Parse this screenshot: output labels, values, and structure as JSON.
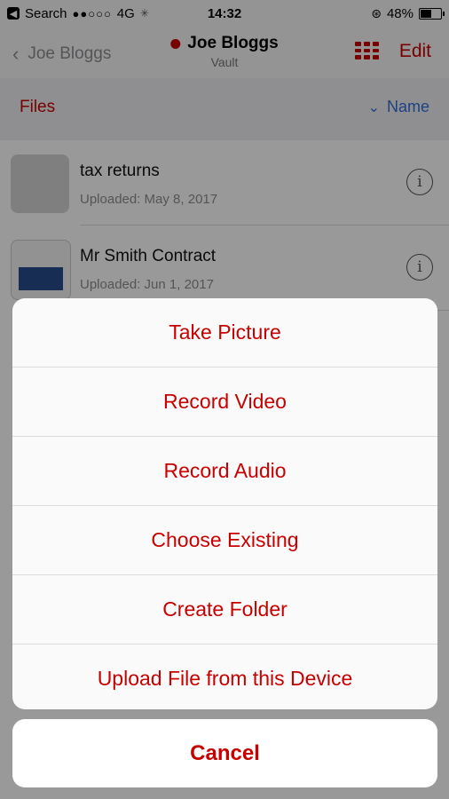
{
  "status_bar": {
    "carrier": "Search",
    "signal": "●●○○○",
    "network": "4G",
    "time": "14:32",
    "battery": "48%",
    "battery_level": 0.48
  },
  "nav": {
    "back_label": "Joe Bloggs",
    "title": "Joe Bloggs",
    "subtitle": "Vault",
    "edit_label": "Edit"
  },
  "files_header": {
    "title": "Files",
    "sort_label": "Name"
  },
  "files": [
    {
      "name": "tax returns",
      "date": "Uploaded: May 8, 2017"
    },
    {
      "name": "Mr Smith Contract",
      "date": "Uploaded: Jun 1, 2017"
    }
  ],
  "action_sheet": {
    "options": [
      "Take Picture",
      "Record Video",
      "Record Audio",
      "Choose Existing",
      "Create Folder",
      "Upload File from this Device"
    ],
    "cancel": "Cancel"
  },
  "colors": {
    "accent": "#c80000",
    "sort_blue": "#2f6fd6"
  }
}
